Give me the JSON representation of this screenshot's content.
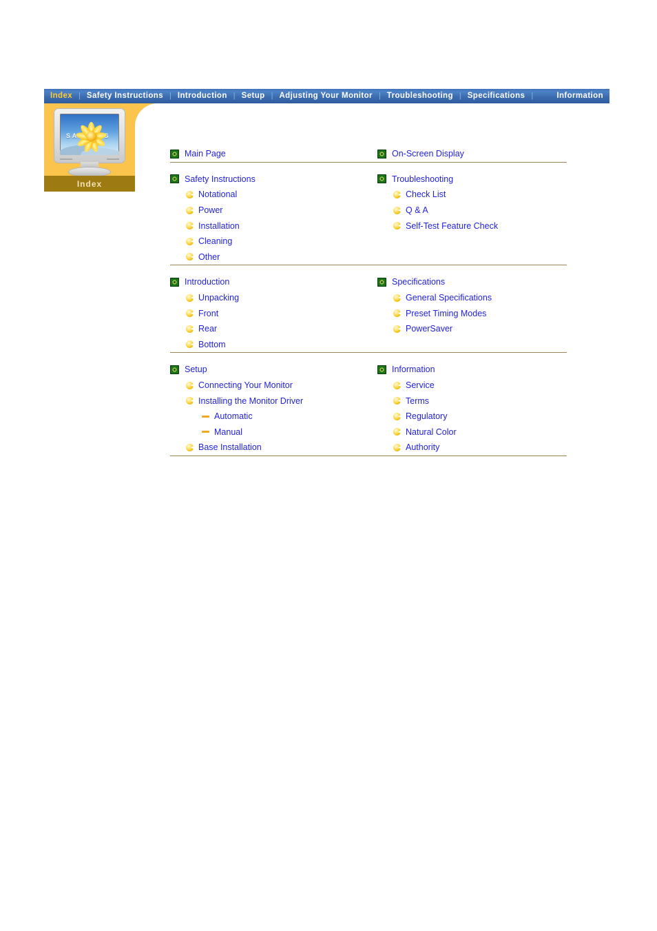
{
  "nav": {
    "items": [
      {
        "label": "Index",
        "active": true
      },
      {
        "label": "Safety Instructions",
        "active": false
      },
      {
        "label": "Introduction",
        "active": false
      },
      {
        "label": "Setup",
        "active": false
      },
      {
        "label": "Adjusting Your Monitor",
        "active": false
      },
      {
        "label": "Troubleshooting",
        "active": false
      },
      {
        "label": "Specifications",
        "active": false
      },
      {
        "label": "Information",
        "active": false
      }
    ],
    "separator": "|"
  },
  "index_panel": {
    "caption": "Index",
    "monitor_brand": "SAMSUNG"
  },
  "colors": {
    "nav_bar_blue": "#3c6cb0",
    "nav_active_text": "#ffcc33",
    "nav_text": "#ffffff",
    "panel_yellow": "#fbc44d",
    "panel_gold": "#9e7a12",
    "link_blue": "#2222dd",
    "divider": "#9a8653",
    "bullet_gold": "#f0c013",
    "square_green": "#1d7a1d"
  },
  "groups": [
    {
      "left": [
        {
          "label": "Main Page",
          "icon": "square-green-icon",
          "level": 0
        }
      ],
      "right": [
        {
          "label": "On-Screen Display",
          "icon": "square-green-icon",
          "level": 0
        }
      ]
    },
    {
      "left": [
        {
          "label": "Safety Instructions",
          "icon": "square-green-icon",
          "level": 0
        },
        {
          "label": "Notational",
          "icon": "gold-bullet-icon",
          "level": 1
        },
        {
          "label": "Power",
          "icon": "gold-bullet-icon",
          "level": 1
        },
        {
          "label": "Installation",
          "icon": "gold-bullet-icon",
          "level": 1
        },
        {
          "label": "Cleaning",
          "icon": "gold-bullet-icon",
          "level": 1
        },
        {
          "label": "Other",
          "icon": "gold-bullet-icon",
          "level": 1
        }
      ],
      "right": [
        {
          "label": "Troubleshooting",
          "icon": "square-green-icon",
          "level": 0
        },
        {
          "label": "Check List",
          "icon": "gold-bullet-icon",
          "level": 1
        },
        {
          "label": "Q & A",
          "icon": "gold-bullet-icon",
          "level": 1
        },
        {
          "label": "Self-Test Feature Check",
          "icon": "gold-bullet-icon",
          "level": 1
        }
      ]
    },
    {
      "left": [
        {
          "label": "Introduction",
          "icon": "square-green-icon",
          "level": 0
        },
        {
          "label": "Unpacking",
          "icon": "gold-bullet-icon",
          "level": 1
        },
        {
          "label": "Front",
          "icon": "gold-bullet-icon",
          "level": 1
        },
        {
          "label": "Rear",
          "icon": "gold-bullet-icon",
          "level": 1
        },
        {
          "label": "Bottom",
          "icon": "gold-bullet-icon",
          "level": 1
        }
      ],
      "right": [
        {
          "label": "Specifications",
          "icon": "square-green-icon",
          "level": 0
        },
        {
          "label": "General Specifications",
          "icon": "gold-bullet-icon",
          "level": 1
        },
        {
          "label": "Preset Timing Modes",
          "icon": "gold-bullet-icon",
          "level": 1
        },
        {
          "label": "PowerSaver",
          "icon": "gold-bullet-icon",
          "level": 1
        }
      ]
    },
    {
      "left": [
        {
          "label": "Setup",
          "icon": "square-green-icon",
          "level": 0
        },
        {
          "label": "Connecting Your Monitor",
          "icon": "gold-bullet-icon",
          "level": 1
        },
        {
          "label": "Installing the Monitor Driver",
          "icon": "gold-bullet-icon",
          "level": 1
        },
        {
          "label": "Automatic",
          "icon": "orange-dash-icon",
          "level": 2
        },
        {
          "label": "Manual",
          "icon": "orange-dash-icon",
          "level": 2
        },
        {
          "label": "Base Installation",
          "icon": "gold-bullet-icon",
          "level": 1
        }
      ],
      "right": [
        {
          "label": "Information",
          "icon": "square-green-icon",
          "level": 0
        },
        {
          "label": "Service",
          "icon": "gold-bullet-icon",
          "level": 1
        },
        {
          "label": "Terms",
          "icon": "gold-bullet-icon",
          "level": 1
        },
        {
          "label": "Regulatory",
          "icon": "gold-bullet-icon",
          "level": 1
        },
        {
          "label": "Natural Color",
          "icon": "gold-bullet-icon",
          "level": 1
        },
        {
          "label": "Authority",
          "icon": "gold-bullet-icon",
          "level": 1
        }
      ]
    }
  ]
}
